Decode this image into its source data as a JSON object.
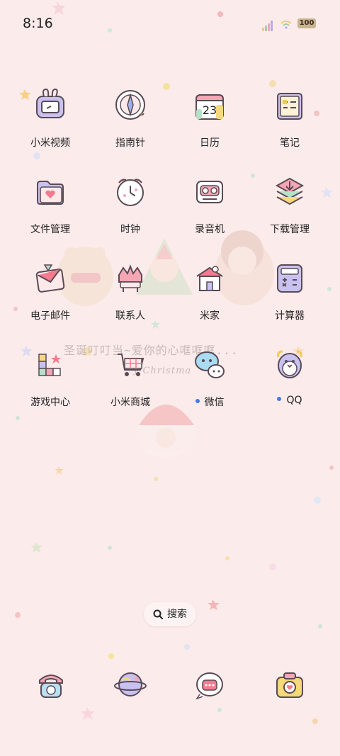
{
  "status": {
    "time": "8:16",
    "battery": "100"
  },
  "wallpaper_text": {
    "line1": "圣诞叮叮当~爱你的心哐哐哐...",
    "line2": "y Christma"
  },
  "apps": [
    {
      "label": "小米视频",
      "icon": "tv-bunny-icon"
    },
    {
      "label": "指南针",
      "icon": "compass-icon"
    },
    {
      "label": "日历",
      "icon": "calendar-icon",
      "date": "23"
    },
    {
      "label": "笔记",
      "icon": "notes-icon"
    },
    {
      "label": "文件管理",
      "icon": "folder-icon"
    },
    {
      "label": "时钟",
      "icon": "clock-icon"
    },
    {
      "label": "录音机",
      "icon": "recorder-icon"
    },
    {
      "label": "下载管理",
      "icon": "download-icon"
    },
    {
      "label": "电子邮件",
      "icon": "mail-icon"
    },
    {
      "label": "联系人",
      "icon": "contacts-icon"
    },
    {
      "label": "米家",
      "icon": "home-icon"
    },
    {
      "label": "计算器",
      "icon": "calculator-icon"
    },
    {
      "label": "游戏中心",
      "icon": "game-center-icon"
    },
    {
      "label": "小米商城",
      "icon": "shopping-cart-icon"
    },
    {
      "label": "微信",
      "icon": "wechat-icon",
      "new": true
    },
    {
      "label": "QQ",
      "icon": "qq-penguin-icon",
      "new": true
    }
  ],
  "search": {
    "label": "搜索"
  },
  "dock": [
    {
      "name": "phone",
      "icon": "phone-icon"
    },
    {
      "name": "browser",
      "icon": "planet-icon"
    },
    {
      "name": "messages",
      "icon": "message-bubble-icon"
    },
    {
      "name": "camera",
      "icon": "camera-icon"
    }
  ],
  "colors": {
    "background": "#fcebeb",
    "new_dot": "#3d7bf5",
    "icon_outline": "#5a4a55"
  }
}
